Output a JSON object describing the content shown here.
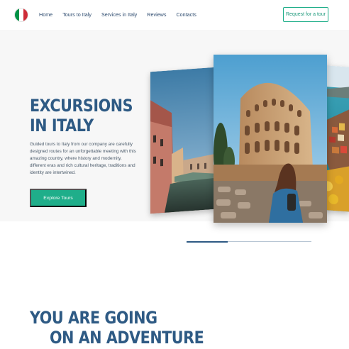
{
  "header": {
    "flag_icon": "italy-flag-icon",
    "flag_colors": [
      "#009246",
      "#ffffff",
      "#ce2b37"
    ],
    "nav": [
      "Home",
      "Tours to Italy",
      "Services in Italy",
      "Reviews",
      "Contacts"
    ],
    "cta_label": "Request for a tour"
  },
  "hero": {
    "title_line1": "EXCURSIONS",
    "title_line2": "IN ITALY",
    "description": "Guided tours to Italy from our company are carefully designed routes for an unforgettable meeting with this amazing country, where history and modernity, different eras and rich cultural heritage, traditions and identity are intertwined.",
    "button_label": "Explore Tours",
    "photos": [
      "venice-canal-photo",
      "colosseum-photo",
      "cinque-terre-photo"
    ],
    "slider_progress": 0.33
  },
  "section": {
    "title_line1": "YOU ARE GOING",
    "title_line2": "ON AN ADVENTURE"
  },
  "colors": {
    "accent": "#1fae8a",
    "heading": "#2e5a84",
    "text": "#4a5a6a"
  }
}
